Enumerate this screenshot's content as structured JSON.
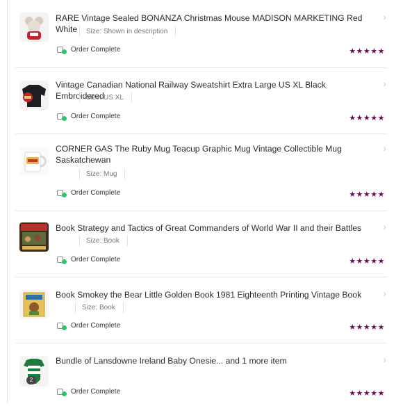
{
  "orders": [
    {
      "title": "RARE Vintage Sealed BONANZA Christmas Mouse MADISON MARKETING Red White",
      "size": "Size: Shown in description",
      "status": "Order Complete",
      "rating_stars": 5,
      "stars": "★★★★★",
      "thumb_icon": "christmas-mouse-plush-icon"
    },
    {
      "title": "Vintage Canadian National Railway Sweatshirt Extra Large US XL Black Embroidered",
      "size": "Size: US XL",
      "status": "Order Complete",
      "rating_stars": 5,
      "stars": "★★★★★",
      "thumb_icon": "black-sweatshirt-icon"
    },
    {
      "title": "CORNER GAS The Ruby Mug Teacup Graphic Mug Vintage Collectible Mug Saskatchewan",
      "size": "Size: Mug",
      "status": "Order Complete",
      "rating_stars": 5,
      "stars": "★★★★★",
      "thumb_icon": "mug-icon"
    },
    {
      "title": "Book Strategy and Tactics of Great Commanders of World War II and their Battles",
      "size": "Size: Book",
      "status": "Order Complete",
      "rating_stars": 5,
      "stars": "★★★★★",
      "thumb_icon": "book-cover-icon"
    },
    {
      "title": "Book Smokey the Bear Little Golden Book 1981 Eighteenth Printing Vintage Book",
      "size": "Size: Book",
      "status": "Order Complete",
      "rating_stars": 5,
      "stars": "★★★★★",
      "thumb_icon": "golden-book-icon"
    },
    {
      "title": "Bundle of Lansdowne Ireland Baby Onesie... and 1 more item",
      "size": "",
      "status": "Order Complete",
      "rating_stars": 5,
      "stars": "★★★★★",
      "badge": "2",
      "thumb_icon": "baby-onesie-icon"
    }
  ]
}
